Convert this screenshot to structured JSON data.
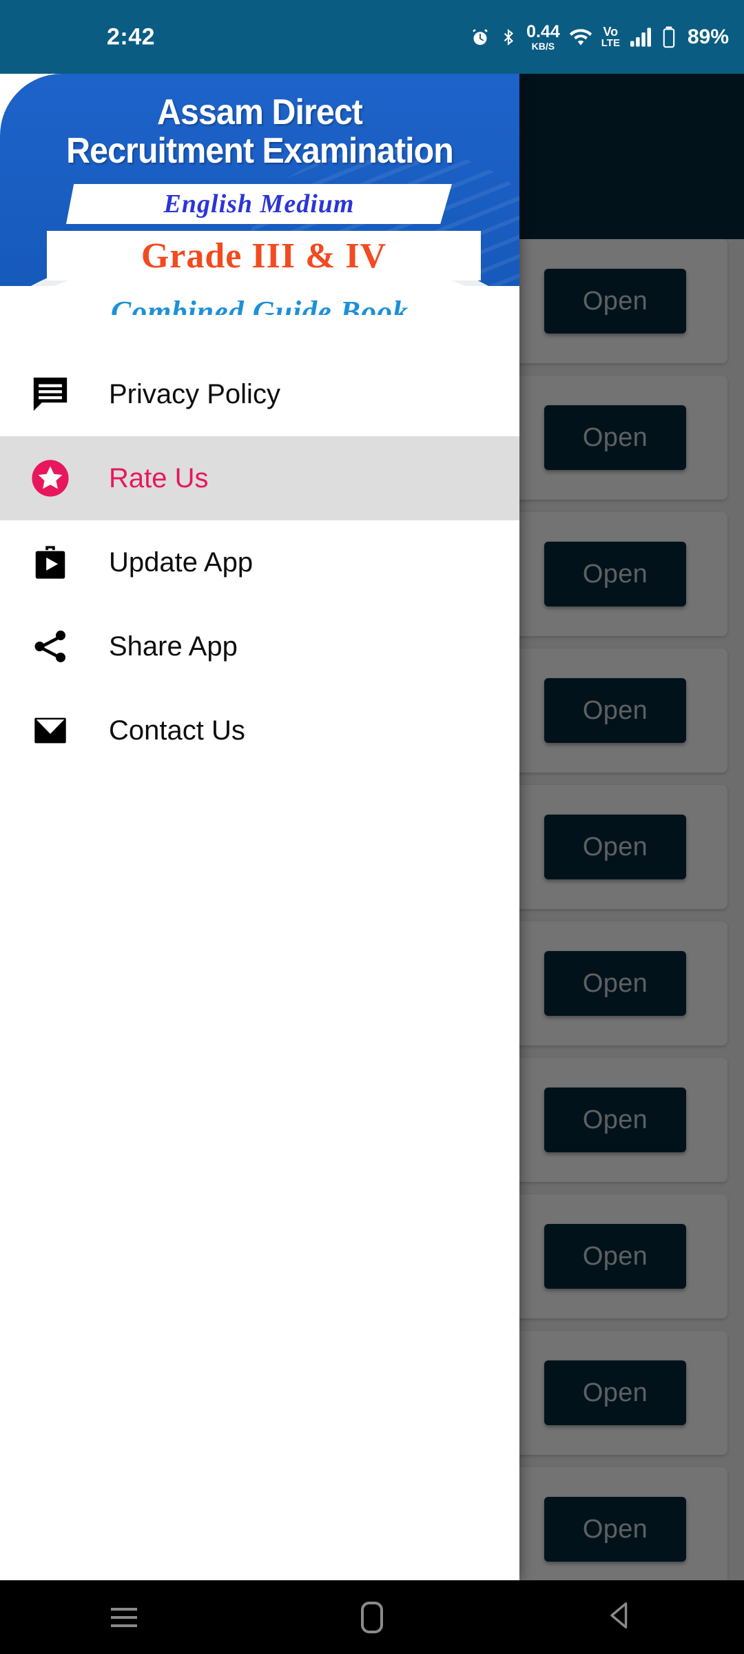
{
  "status_bar": {
    "time": "2:42",
    "battery_percent": "89%",
    "network_speed_value": "0.44",
    "network_speed_unit": "KB/S",
    "volte_top": "Vo",
    "volte_bottom": "LTE",
    "icons": [
      "alarm-icon",
      "bluetooth-icon",
      "wifi-icon",
      "volte-icon",
      "signal-icon",
      "battery-icon"
    ],
    "background_color": "#0a5c82"
  },
  "drawer": {
    "banner": {
      "title_line1": "Assam Direct",
      "title_line2": "Recruitment Examination",
      "ribbon_medium": "English Medium",
      "ribbon_grade": "Grade III & IV",
      "subtitle": "Combined Guide Book",
      "blue_color": "#1a5ec2",
      "medium_text_color": "#2b35d8",
      "grade_text_color": "#f24a21",
      "subtitle_color": "#1e90d8"
    },
    "menu_items": [
      {
        "label": "Privacy Policy",
        "icon": "comment-lines-icon",
        "selected": false
      },
      {
        "label": "Rate Us",
        "icon": "star-circle-icon",
        "selected": true
      },
      {
        "label": "Update App",
        "icon": "play-store-bag-icon",
        "selected": false
      },
      {
        "label": "Share App",
        "icon": "share-icon",
        "selected": false
      },
      {
        "label": "Contact Us",
        "icon": "envelope-icon",
        "selected": false
      }
    ],
    "selected_color": "#e8175d",
    "selected_row_bg": "#dddddd"
  },
  "content": {
    "app_bar_color": "#06293d",
    "open_button_label": "Open",
    "card_count": 10,
    "cards": [
      {
        "button_label": "Open"
      },
      {
        "button_label": "Open"
      },
      {
        "button_label": "Open"
      },
      {
        "button_label": "Open"
      },
      {
        "button_label": "Open"
      },
      {
        "button_label": "Open"
      },
      {
        "button_label": "Open"
      },
      {
        "button_label": "Open"
      },
      {
        "button_label": "Open"
      },
      {
        "button_label": "Open"
      }
    ]
  },
  "nav_bar": {
    "items": [
      "recents-button",
      "home-button",
      "back-button"
    ],
    "background_color": "#000000",
    "icon_color": "#8a8a8a"
  }
}
